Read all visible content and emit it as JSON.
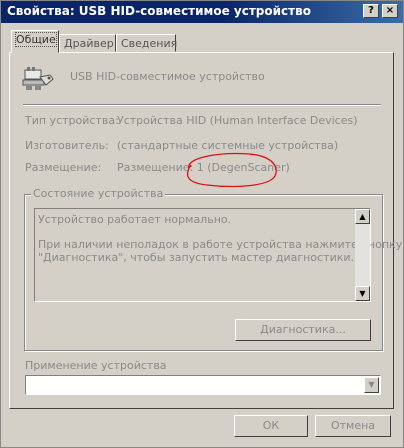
{
  "window": {
    "title": "Свойства: USB HID-совместимое устройство"
  },
  "titlebar_buttons": {
    "help": "?",
    "close": "×"
  },
  "tabs": [
    {
      "label": "Общие",
      "active": true
    },
    {
      "label": "Драйвер",
      "active": false
    },
    {
      "label": "Сведения",
      "active": false
    }
  ],
  "device": {
    "name": "USB HID-совместимое устройство"
  },
  "properties": [
    {
      "label": "Тип устройства:",
      "value": "Устройства HID (Human Interface Devices)"
    },
    {
      "label": "Изготовитель:",
      "value": "(стандартные системные устройства)"
    },
    {
      "label": "Размещение:",
      "value": "Размещение: 1 (DegenScaner)"
    }
  ],
  "status": {
    "group_title": "Состояние устройства",
    "line1": "Устройство работает нормально.",
    "line2": "При наличии неполадок в работе устройства нажмите кнопку",
    "line3": "\"Диагностика\", чтобы запустить мастер диагностики.",
    "diagnostics_button": "Диагностика..."
  },
  "usage": {
    "group_title": "Применение устройства",
    "selected": ""
  },
  "footer": {
    "ok": "ОК",
    "cancel": "Отмена"
  },
  "colors": {
    "titlebar": "#0a246a",
    "face": "#d4d0c8",
    "annotation": "#e01010"
  }
}
